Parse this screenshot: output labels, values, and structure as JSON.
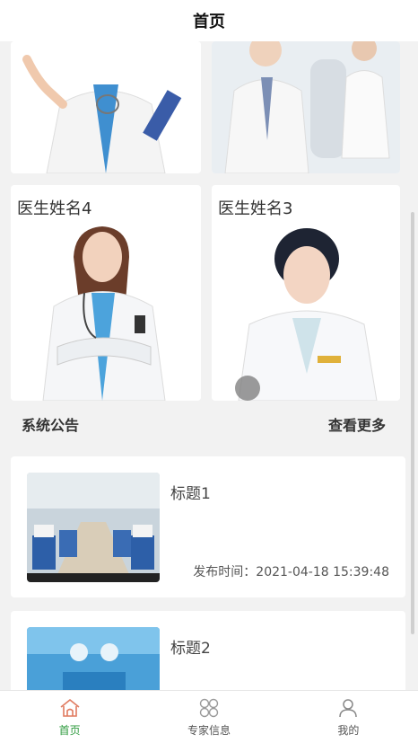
{
  "header": {
    "title": "首页"
  },
  "doctors": [
    {
      "name": "医生姓名4"
    },
    {
      "name": "医生姓名3"
    }
  ],
  "notice_section": {
    "title": "系统公告",
    "more_label": "查看更多"
  },
  "news": [
    {
      "title": "标题1",
      "time": "发布时间：2021-04-18 15:39:48"
    },
    {
      "title": "标题2"
    }
  ],
  "tabbar": {
    "items": [
      {
        "label": "首页",
        "icon": "home-icon",
        "active": true
      },
      {
        "label": "专家信息",
        "icon": "grid-icon",
        "active": false
      },
      {
        "label": "我的",
        "icon": "user-icon",
        "active": false
      }
    ],
    "active_color": "#2f9b3f",
    "inactive_color": "#555555"
  }
}
